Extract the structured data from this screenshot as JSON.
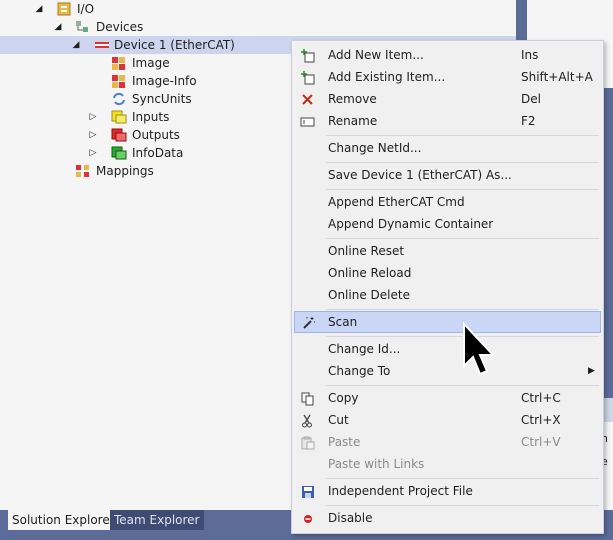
{
  "tree": {
    "io": "I/O",
    "devices": "Devices",
    "device1": "Device 1 (EtherCAT)",
    "image": "Image",
    "image_info": "Image-Info",
    "syncunits": "SyncUnits",
    "inputs": "Inputs",
    "outputs": "Outputs",
    "infodata": "InfoData",
    "mappings": "Mappings"
  },
  "right_fragments": {
    "frag1": "n",
    "frag2": "e"
  },
  "tabs": {
    "solution_explorer": "Solution Explorer",
    "team_explorer": "Team Explorer"
  },
  "menu": {
    "add_new_item": "Add New Item...",
    "add_new_item_shortcut": "Ins",
    "add_existing_item": "Add Existing Item...",
    "add_existing_item_shortcut": "Shift+Alt+A",
    "remove": "Remove",
    "remove_shortcut": "Del",
    "rename": "Rename",
    "rename_shortcut": "F2",
    "change_netid": "Change NetId...",
    "save_device_as": "Save Device 1 (EtherCAT) As...",
    "append_ethercat_cmd": "Append EtherCAT Cmd",
    "append_dynamic_container": "Append Dynamic Container",
    "online_reset": "Online Reset",
    "online_reload": "Online Reload",
    "online_delete": "Online Delete",
    "scan": "Scan",
    "change_id": "Change Id...",
    "change_to": "Change To",
    "copy": "Copy",
    "copy_shortcut": "Ctrl+C",
    "cut": "Cut",
    "cut_shortcut": "Ctrl+X",
    "paste": "Paste",
    "paste_shortcut": "Ctrl+V",
    "paste_with_links": "Paste with Links",
    "independent_project_file": "Independent Project File",
    "disable": "Disable"
  },
  "icons": {
    "expanded": "expanded-triangle",
    "collapsed": "collapsed-triangle",
    "submenu_arrow": "submenu-arrow"
  },
  "colors": {
    "selection": "#ccd4ee",
    "menu_highlight": "#c9d6f5",
    "chrome_blue": "#5d6b99"
  }
}
